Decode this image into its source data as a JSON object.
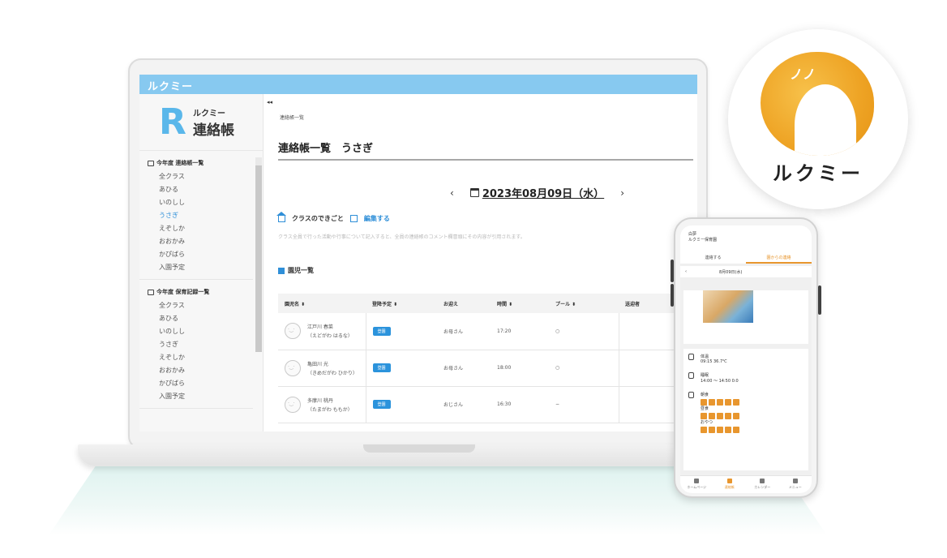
{
  "app": {
    "topbar_title": "ルクミー",
    "logo_small": "ルクミー",
    "logo_big": "連絡帳"
  },
  "sidebar": {
    "sections": [
      {
        "heading": "今年度 連絡帳一覧",
        "items": [
          "全クラス",
          "あひる",
          "いのしし",
          "うさぎ",
          "えぞしか",
          "おおかみ",
          "かぴばら",
          "入園予定"
        ],
        "active_index": 3
      },
      {
        "heading": "今年度 保育記録一覧",
        "items": [
          "全クラス",
          "あひる",
          "いのしし",
          "うさぎ",
          "えぞしか",
          "おおかみ",
          "かぴばら",
          "入園予定"
        ]
      }
    ]
  },
  "main": {
    "breadcrumb": "連絡帳一覧",
    "page_title": "連絡帳一覧　うさぎ",
    "date": "2023年08月09日（水）",
    "prev_arrow": "‹",
    "next_arrow": "›",
    "class_event_label": "クラスのできごと",
    "edit_label": "編集する",
    "note": "クラス全員で行った活動や行事について記入すると、全員の連絡帳のコメント欄冒頭にその内容が引用されます。",
    "list_heading": "園児一覧",
    "table": {
      "headers": [
        "園児名 ⬍",
        "登降予定 ⬍",
        "お迎え",
        "時間 ⬍",
        "プール ⬍",
        "送迎者"
      ],
      "rows": [
        {
          "name": "江戸川 春菜",
          "kana": "（えどがわ はるな）",
          "status": "登園",
          "pickup": "お母さん",
          "time": "17:20",
          "pool": "○"
        },
        {
          "name": "亀田川 光",
          "kana": "（きめだがわ ひかり）",
          "status": "登園",
          "pickup": "お母さん",
          "time": "18:00",
          "pool": "○"
        },
        {
          "name": "多摩川 桃丹",
          "kana": "（たまがわ ももか）",
          "status": "登園",
          "pickup": "おじさん",
          "time": "16:30",
          "pool": "−"
        }
      ]
    }
  },
  "brand": {
    "name": "ルクミー",
    "lines": "ノノ"
  },
  "phone": {
    "header_line1": "白夢",
    "header_line2": "ルクミー保育園",
    "tabs": [
      "連絡する",
      "園からの連絡"
    ],
    "active_tab": 1,
    "back_arrow": "‹",
    "date": "8月09日(水)",
    "info": [
      {
        "label": "体温",
        "value": "09:15 36.7℃"
      },
      {
        "label": "睡眠",
        "value": "14:00 〜 14:50 0:0"
      },
      {
        "label": "食事",
        "value": ""
      }
    ],
    "meal_labels": [
      "朝食",
      "昼食",
      "おやつ"
    ],
    "nav": [
      "ホームページ",
      "連絡帳",
      "カレンダー",
      "メニュー"
    ],
    "nav_active": 1
  },
  "colors": {
    "topbar": "#87c9f0",
    "accent_blue": "#2f8fd8",
    "brand_orange": "#eea324",
    "phone_accent": "#e8962e"
  }
}
